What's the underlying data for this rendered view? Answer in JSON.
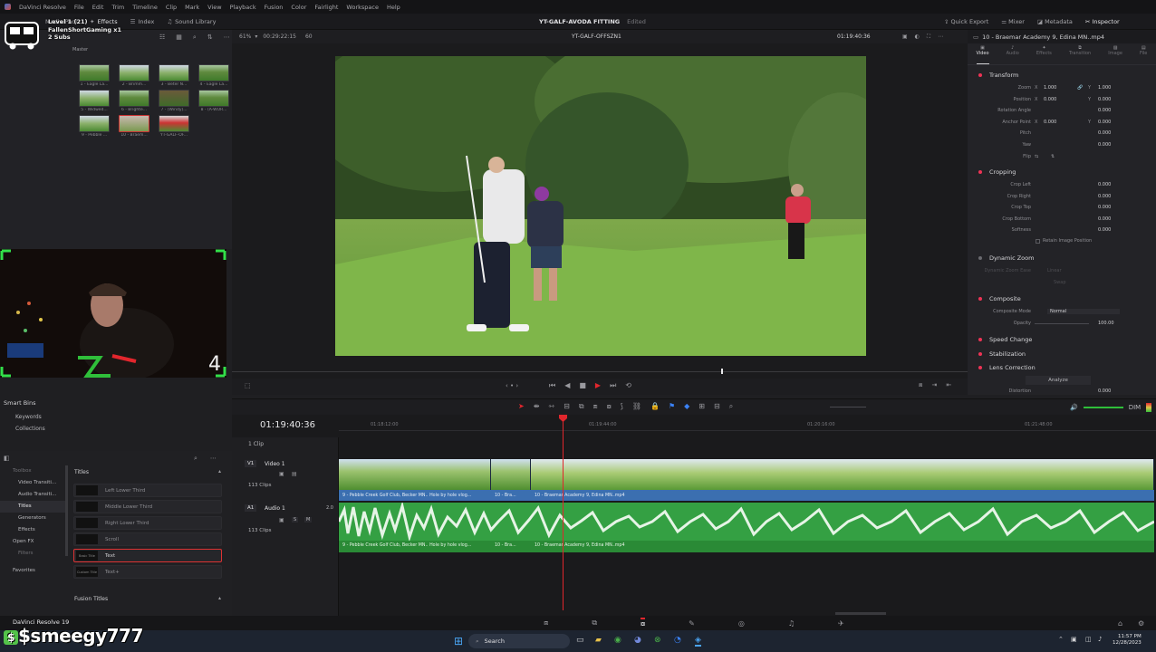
{
  "menubar": {
    "app": "DaVinci Resolve",
    "items": [
      "File",
      "Edit",
      "Trim",
      "Timeline",
      "Clip",
      "Mark",
      "View",
      "Playback",
      "Fusion",
      "Color",
      "Fairlight",
      "Workspace",
      "Help"
    ]
  },
  "toolbar": {
    "media_pool": "Media Pool",
    "effects": "Effects",
    "index": "Index",
    "sound_library": "Sound Library",
    "project_title": "YT-GALF-AVODA FITTING",
    "edited": "Edited",
    "quick_export": "Quick Export",
    "mixer": "Mixer",
    "metadata": "Metadata",
    "inspector": "Inspector"
  },
  "stream": {
    "level": "Level 1  (21)",
    "gifter": "FallenShortGaming x1",
    "subs": "2 Subs",
    "webcam_count": "4",
    "name": "$smeegy777"
  },
  "media_pool": {
    "bin": "Master",
    "clips": [
      {
        "label": "1 - Eagle La..."
      },
      {
        "label": "2 - Brimm..."
      },
      {
        "label": "3 - Beter N..."
      },
      {
        "label": "4 - Eagle La..."
      },
      {
        "label": "5 - Widwed..."
      },
      {
        "label": "6 - Brighte..."
      },
      {
        "label": "7 - (Windy)..."
      },
      {
        "label": "8 - (A-WOR..."
      },
      {
        "label": "9 - Pebble ..."
      },
      {
        "label": "10 - Braem..."
      },
      {
        "label": "YT-GALF-OF..."
      }
    ]
  },
  "viewer": {
    "zoom": "61%",
    "source_tc": "00:29:22:15",
    "fps": "60",
    "timeline_name": "YT-GALF-OFFSZN1",
    "record_tc": "01:19:40:36"
  },
  "smart_bins": {
    "title": "Smart Bins",
    "items": [
      "Keywords",
      "Collections"
    ]
  },
  "effects": {
    "tree": [
      "Toolbox",
      "Video Transiti...",
      "Audio Transiti...",
      "Titles",
      "Generators",
      "Effects",
      "Open FX",
      "Filters"
    ],
    "favorites": "Favorites",
    "titles_header": "Titles",
    "titles": [
      {
        "thumb": "",
        "name": "Left Lower Third"
      },
      {
        "thumb": "",
        "name": "Middle Lower Third"
      },
      {
        "thumb": "",
        "name": "Right Lower Third"
      },
      {
        "thumb": "",
        "name": "Scroll"
      },
      {
        "thumb": "Basic Title",
        "name": "Text"
      },
      {
        "thumb": "Custom Title",
        "name": "Text+"
      }
    ],
    "fusion_titles": "Fusion Titles"
  },
  "inspector": {
    "clip_name": "10 - Braemar Academy 9, Edina MN..mp4",
    "tabs": [
      "Video",
      "Audio",
      "Effects",
      "Transition",
      "Image",
      "File"
    ],
    "transform": "Transform",
    "zoom_label": "Zoom",
    "zoom_x": "1.000",
    "zoom_y": "1.000",
    "position_label": "Position",
    "position_x": "0.000",
    "position_y": "0.000",
    "rotation_label": "Rotation Angle",
    "rotation": "0.000",
    "anchor_label": "Anchor Point",
    "anchor_x": "0.000",
    "anchor_y": "0.000",
    "pitch_label": "Pitch",
    "pitch": "0.000",
    "yaw_label": "Yaw",
    "yaw": "0.000",
    "flip_label": "Flip",
    "cropping": "Cropping",
    "crop_left_label": "Crop Left",
    "crop_left": "0.000",
    "crop_right_label": "Crop Right",
    "crop_right": "0.000",
    "crop_top_label": "Crop Top",
    "crop_top": "0.000",
    "crop_bottom_label": "Crop Bottom",
    "crop_bottom": "0.000",
    "softness_label": "Softness",
    "softness": "0.000",
    "retain_label": "Retain Image Position",
    "dynamic_zoom": "Dynamic Zoom",
    "dz_ease_label": "Dynamic Zoom Ease",
    "dz_ease": "Linear",
    "dz_swap": "Swap",
    "composite": "Composite",
    "composite_mode_label": "Composite Mode",
    "composite_mode": "Normal",
    "opacity_label": "Opacity",
    "opacity": "100.00",
    "speed_change": "Speed Change",
    "stabilization": "Stabilization",
    "lens_correction": "Lens Correction",
    "analyze": "Analyze",
    "distortion_label": "Distortion",
    "distortion": "0.000"
  },
  "timeline": {
    "timecode": "01:19:40:36",
    "clip_count": "1 Clip",
    "ruler": [
      "01:18:12:00",
      "01:19:44:00",
      "01:20:16:00",
      "01:21:48:00"
    ],
    "video_track": {
      "id": "V1",
      "name": "Video 1",
      "clips": "113 Clips"
    },
    "audio_track": {
      "id": "A1",
      "name": "Audio 1",
      "level": "2.0",
      "clips": "113 Clips"
    },
    "video_clips": [
      "9 - Pebble Creek Golf Club, Becker MN.. Hole by hole vlog...",
      "10 - Bra...",
      "10 - Braemar Academy 9, Edina MN..mp4"
    ],
    "audio_clips": [
      "9 - Pebble Creek Golf Club, Becker MN.. Hole by hole vlog...",
      "10 - Bra...",
      "10 - Braemar Academy 9, Edina MN..mp4"
    ],
    "audio_meter": "DIM"
  },
  "status": {
    "resolve_version": "DaVinci Resolve 19"
  },
  "taskbar": {
    "search": "Search",
    "time": "11:57 PM",
    "date": "12/28/2023"
  }
}
